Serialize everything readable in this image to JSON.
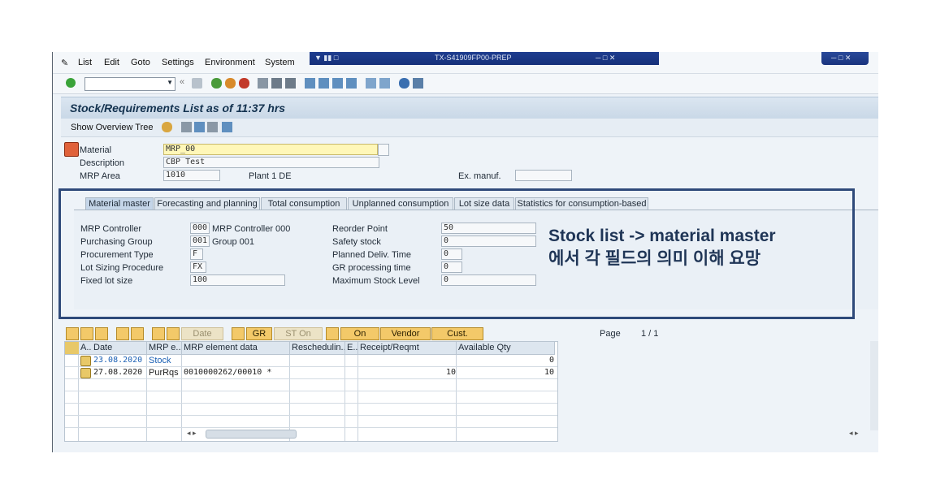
{
  "menu": {
    "items": [
      "List",
      "Edit",
      "Goto",
      "Settings",
      "Environment",
      "System"
    ]
  },
  "window": {
    "title": "TX-S41909FP00-PREP"
  },
  "screen": {
    "title": "Stock/Requirements List as of 11:37 hrs",
    "show_overview_tree": "Show Overview Tree"
  },
  "header": {
    "material_label": "Material",
    "material_value": "MRP_00",
    "description_label": "Description",
    "description_value": "CBP Test",
    "mrp_area_label": "MRP Area",
    "mrp_area_value": "1010",
    "mrp_area_text": "Plant 1 DE",
    "ex_manuf_label": "Ex. manuf."
  },
  "tabs": [
    "Material master",
    "Forecasting and planning",
    "Total consumption",
    "Unplanned consumption",
    "Lot size data",
    "Statistics for consumption-based"
  ],
  "material_master": {
    "left": [
      {
        "label": "MRP Controller",
        "value": "000",
        "text": "MRP Controller 000"
      },
      {
        "label": "Purchasing Group",
        "value": "001",
        "text": "Group 001"
      },
      {
        "label": "Procurement Type",
        "value": "F",
        "text": ""
      },
      {
        "label": "Lot Sizing Procedure",
        "value": "FX",
        "text": ""
      },
      {
        "label": "Fixed lot size",
        "value": "100",
        "text": ""
      }
    ],
    "right": [
      {
        "label": "Reorder Point",
        "value": "50"
      },
      {
        "label": "Safety stock",
        "value": "0"
      },
      {
        "label": "Planned Deliv. Time",
        "value": "0"
      },
      {
        "label": "GR processing time",
        "value": "0"
      },
      {
        "label": "Maximum Stock Level",
        "value": "0"
      }
    ]
  },
  "annotation": {
    "line1": "Stock list -> material master",
    "line2": "에서 각 필드의 의미 이해 요망"
  },
  "grid_toolbar": {
    "date": "Date",
    "gr": "GR",
    "st_on": "ST On",
    "on": "On",
    "vendor": "Vendor",
    "cust": "Cust.",
    "page_label": "Page",
    "page_value": "1 / 1"
  },
  "grid": {
    "columns": [
      "A..",
      "Date",
      "MRP e...",
      "MRP element data",
      "Reschedulin...",
      "E..",
      "Receipt/Reqmt",
      "Available Qty"
    ],
    "rows": [
      {
        "date": "23.08.2020",
        "element": "Stock",
        "data": "",
        "receipt": "",
        "available": "0"
      },
      {
        "date": "27.08.2020",
        "element": "PurRqs",
        "data": "0010000262/00010 *",
        "receipt": "10",
        "available": "10"
      }
    ]
  },
  "colors": {
    "accent": "#f3c969",
    "title_band": "#1e3d8f",
    "overlay_border": "#2f4a7a",
    "stock_link": "#1a5fb4"
  }
}
